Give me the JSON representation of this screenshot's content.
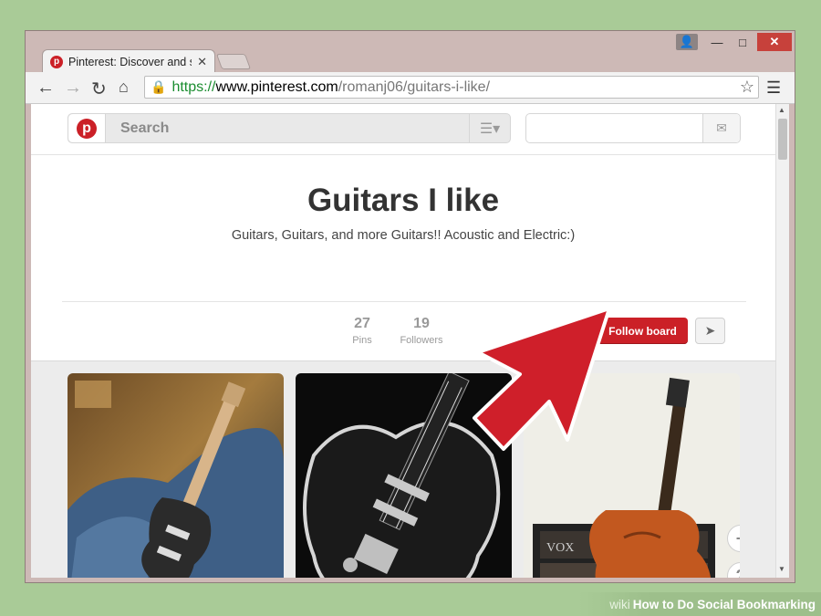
{
  "browser": {
    "tab_title": "Pinterest: Discover and sa",
    "url_scheme": "https://",
    "url_host": "www.pinterest.com",
    "url_path": "/romanj06/guitars-i-like/"
  },
  "header": {
    "search_placeholder": "Search"
  },
  "board": {
    "title": "Guitars I like",
    "description": "Guitars, Guitars, and more Guitars!! Acoustic and Electric:)",
    "pins_count": "27",
    "pins_label": "Pins",
    "followers_count": "19",
    "followers_label": "Followers",
    "follow_button": "Follow board"
  },
  "caption": {
    "wiki": "wiki",
    "text": "How to Do Social Bookmarking"
  },
  "colors": {
    "pinterest_red": "#cb2027",
    "arrow_red": "#cf1f2a",
    "background_green": "#a9cb97"
  },
  "icons": [
    "pinterest-logo-icon",
    "menu-icon",
    "send-icon",
    "plus-icon",
    "help-icon",
    "lock-icon",
    "star-icon"
  ]
}
